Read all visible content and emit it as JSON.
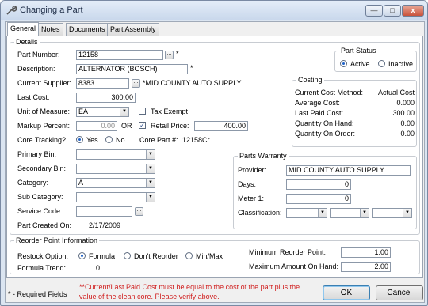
{
  "window": {
    "title": "Changing a Part",
    "min_label": "—",
    "max_label": "□",
    "close_label": "x"
  },
  "tabs": [
    "General",
    "Notes",
    "Documents",
    "Part Assembly"
  ],
  "details": {
    "group_label": "Details",
    "part_number_label": "Part Number:",
    "part_number": "12158",
    "description_label": "Description:",
    "description": "ALTERNATOR (BOSCH)",
    "supplier_label": "Current Supplier:",
    "supplier": "8383",
    "supplier_name": "*MID COUNTY AUTO SUPPLY",
    "last_cost_label": "Last Cost:",
    "last_cost": "300.00",
    "uom_label": "Unit of Measure:",
    "uom": "EA",
    "tax_exempt_label": "Tax Exempt",
    "markup_label": "Markup Percent:",
    "markup": "0.00",
    "or_label": "OR",
    "retail_price_label": "Retail Price:",
    "retail_price": "400.00",
    "core_tracking_label": "Core Tracking?",
    "yes_label": "Yes",
    "no_label": "No",
    "core_part_label": "Core Part #:",
    "core_part": "12158Cr",
    "primary_bin_label": "Primary Bin:",
    "primary_bin": "",
    "secondary_bin_label": "Secondary Bin:",
    "secondary_bin": "",
    "category_label": "Category:",
    "category": "A",
    "sub_category_label": "Sub Category:",
    "sub_category": "",
    "service_code_label": "Service Code:",
    "service_code": "",
    "created_label": "Part Created On:",
    "created": "2/17/2009",
    "required_star": "*"
  },
  "part_status": {
    "group_label": "Part Status",
    "active_label": "Active",
    "inactive_label": "Inactive"
  },
  "costing": {
    "group_label": "Costing",
    "rows": [
      {
        "label": "Current Cost Method:",
        "value": "Actual Cost"
      },
      {
        "label": "Average Cost:",
        "value": "0.000"
      },
      {
        "label": "Last Paid Cost:",
        "value": "300.00"
      },
      {
        "label": "Quantity On Hand:",
        "value": "0.00"
      },
      {
        "label": "Quantity On Order:",
        "value": "0.00"
      }
    ]
  },
  "warranty": {
    "group_label": "Parts Warranty",
    "provider_label": "Provider:",
    "provider": "MID COUNTY AUTO SUPPLY",
    "days_label": "Days:",
    "days": "0",
    "meter_label": "Meter 1:",
    "meter": "0",
    "classification_label": "Classification:"
  },
  "reorder": {
    "group_label": "Reorder Point Information",
    "restock_label": "Restock Option:",
    "formula_label": "Formula",
    "dont_reorder_label": "Don't Reorder",
    "minmax_label": "Min/Max",
    "trend_label": "Formula Trend:",
    "trend": "0",
    "min_point_label": "Minimum Reorder Point:",
    "min_point": "1.00",
    "max_hand_label": "Maximum Amount On Hand:",
    "max_hand": "2.00"
  },
  "footer": {
    "required_note": "* - Required Fields",
    "warning_line1": "**Current/Last Paid Cost must be equal to the cost of the part plus the",
    "warning_line2": "value of the clean core.  Please verify above.",
    "ok_label": "OK",
    "cancel_label": "Cancel"
  },
  "colors": {
    "warning": "#d01f1f",
    "title_bg": "#dbe5f1",
    "radio_dot": "#2063c9"
  }
}
